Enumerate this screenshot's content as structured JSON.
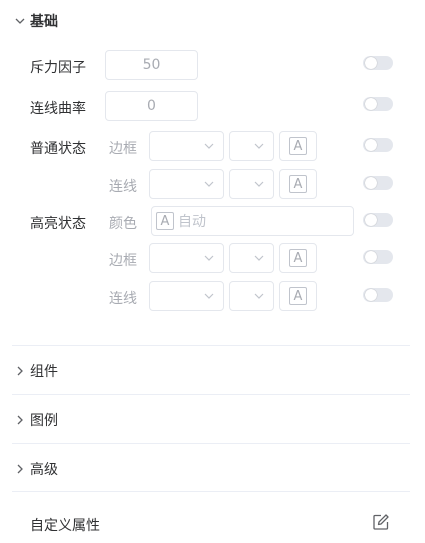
{
  "basic": {
    "title": "基础",
    "repulsion": {
      "label": "斥力因子",
      "value": "50"
    },
    "curveness": {
      "label": "连线曲率",
      "value": "0"
    },
    "normal_state": {
      "label": "普通状态",
      "border_label": "边框",
      "line_label": "连线"
    },
    "highlight_state": {
      "label": "高亮状态",
      "color_label": "颜色",
      "color_placeholder": "自动",
      "border_label": "边框",
      "line_label": "连线"
    },
    "font_glyph": "A"
  },
  "sections": [
    {
      "title": "组件"
    },
    {
      "title": "图例"
    },
    {
      "title": "高级"
    }
  ],
  "custom_attr": {
    "label": "自定义属性"
  },
  "colors": {
    "switch_off": "#e4e7ed",
    "border": "#e4e7ed",
    "placeholder": "#a8abb2"
  }
}
